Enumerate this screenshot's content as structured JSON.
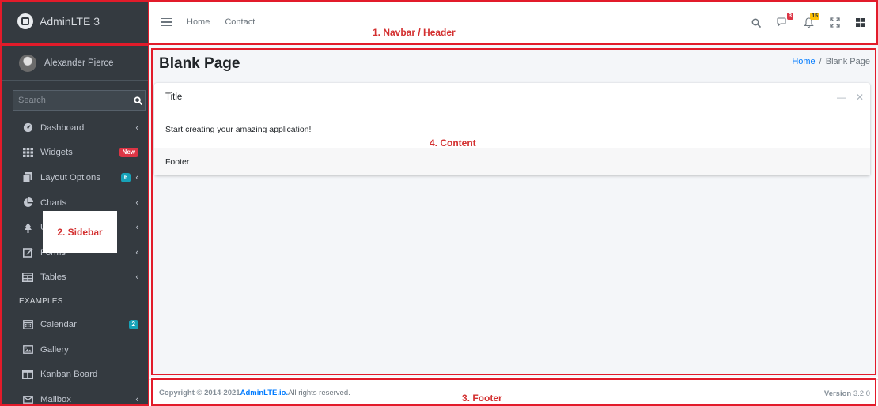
{
  "brand": {
    "name": "AdminLTE 3"
  },
  "user": {
    "name": "Alexander Pierce"
  },
  "search": {
    "placeholder": "Search"
  },
  "sidebar": {
    "items": [
      {
        "label": "Dashboard",
        "icon": "dashboard-icon",
        "chevron": true
      },
      {
        "label": "Widgets",
        "icon": "widgets-grid-icon",
        "badge": "New",
        "badge_color": "#dc3545"
      },
      {
        "label": "Layout Options",
        "icon": "copy-icon",
        "badge": "6",
        "badge_color": "#17a2b8",
        "chevron": true
      },
      {
        "label": "Charts",
        "icon": "pie-chart-icon",
        "chevron": true
      },
      {
        "label": "UI Elements",
        "icon": "tree-icon",
        "chevron": true
      },
      {
        "label": "Forms",
        "icon": "edit-icon",
        "chevron": true
      },
      {
        "label": "Tables",
        "icon": "table-icon",
        "chevron": true
      }
    ],
    "header": "EXAMPLES",
    "examples": [
      {
        "label": "Calendar",
        "icon": "calendar-icon",
        "badge": "2",
        "badge_color": "#17a2b8"
      },
      {
        "label": "Gallery",
        "icon": "image-icon"
      },
      {
        "label": "Kanban Board",
        "icon": "columns-icon"
      },
      {
        "label": "Mailbox",
        "icon": "envelope-icon",
        "chevron": true
      }
    ]
  },
  "navbar": {
    "links": [
      "Home",
      "Contact"
    ],
    "messages_badge": "3",
    "notifications_badge": "15"
  },
  "content": {
    "title": "Blank Page",
    "breadcrumb": {
      "home": "Home",
      "current": "Blank Page"
    },
    "card": {
      "title": "Title",
      "body": "Start creating your amazing application!",
      "footer": "Footer"
    }
  },
  "footer": {
    "copyright_prefix": "Copyright © 2014-2021 ",
    "link": "AdminLTE.io.",
    "suffix": " All rights reserved.",
    "version_label": "Version",
    "version": "3.2.0"
  },
  "annotations": {
    "navbar": "1. Navbar / Header",
    "sidebar": "2. Sidebar",
    "footer": "3. Footer",
    "content": "4. Content"
  },
  "colors": {
    "annotation_red": "#e21b2a",
    "sidebar_bg": "#343a40",
    "link_blue": "#007bff"
  }
}
